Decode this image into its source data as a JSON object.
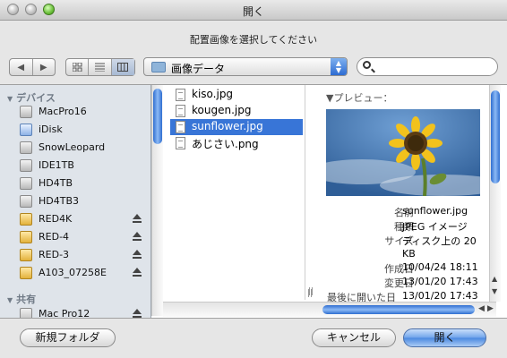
{
  "window": {
    "title": "開く"
  },
  "prompt": "配置画像を選択してください",
  "toolbar": {
    "back_icon": "◀",
    "forward_icon": "▶",
    "location": "画像データ",
    "search_placeholder": ""
  },
  "sidebar": {
    "devices_header": "デバイス",
    "devices": [
      {
        "label": "MacPro16",
        "icon": "hard-drive-icon",
        "eject": false
      },
      {
        "label": "iDisk",
        "icon": "idisk-icon",
        "eject": false
      },
      {
        "label": "SnowLeopard",
        "icon": "hard-drive-icon",
        "eject": false
      },
      {
        "label": "IDE1TB",
        "icon": "hard-drive-icon",
        "eject": false
      },
      {
        "label": "HD4TB",
        "icon": "hard-drive-icon",
        "eject": false
      },
      {
        "label": "HD4TB3",
        "icon": "hard-drive-icon",
        "eject": false
      },
      {
        "label": "RED4K",
        "icon": "memory-card-icon",
        "eject": true
      },
      {
        "label": "RED-4",
        "icon": "memory-card-icon",
        "eject": true
      },
      {
        "label": "RED-3",
        "icon": "memory-card-icon",
        "eject": true
      },
      {
        "label": "A103_07258E",
        "icon": "memory-card-icon",
        "eject": true
      }
    ],
    "shared_header": "共有",
    "shared": [
      {
        "label": "Mac Pro12",
        "icon": "network-computer-icon",
        "eject": true
      }
    ]
  },
  "files": [
    {
      "name": "kiso.jpg",
      "selected": false
    },
    {
      "name": "kougen.jpg",
      "selected": false
    },
    {
      "name": "sunflower.jpg",
      "selected": true
    },
    {
      "name": "あじさい.png",
      "selected": false
    }
  ],
  "preview": {
    "header": "プレビュー：",
    "image_subject": "sunflower",
    "meta": [
      {
        "key": "名前",
        "value": "sunflower.jpg"
      },
      {
        "key": "種類",
        "value": "JPEG イメージ"
      },
      {
        "key": "サイズ",
        "value": "ディスク上の 20"
      },
      {
        "key": "",
        "value": "KB"
      },
      {
        "key": "作成日",
        "value": "10/04/24 18:11"
      },
      {
        "key": "変更日",
        "value": "13/01/20 17:43"
      },
      {
        "key": "最後に開いた日",
        "value": "13/01/20 17:43"
      }
    ]
  },
  "buttons": {
    "new_folder": "新規フォルダ",
    "cancel": "キャンセル",
    "open": "開く"
  },
  "colors": {
    "selection": "#3875d7",
    "sidebar_bg": "#dfe4ea",
    "accent": "#4a88e0"
  }
}
